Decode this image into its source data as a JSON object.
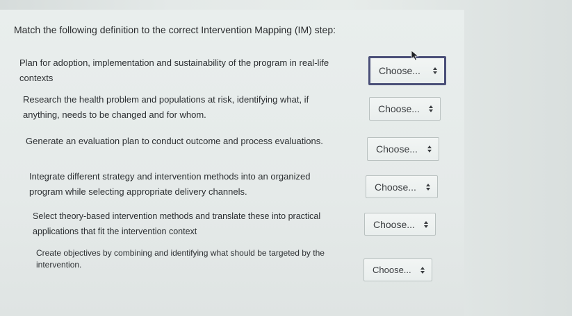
{
  "question": "Match the following definition to the correct Intervention Mapping (IM) step:",
  "placeholder": "Choose...",
  "items": [
    {
      "line1": "Plan for adoption, implementation and sustainability of the program in real-life",
      "line2": "contexts",
      "select_value": "Choose..."
    },
    {
      "line1": "Research the health problem and populations at risk, identifying what, if",
      "line2": "anything, needs to be changed and for whom.",
      "select_value": "Choose..."
    },
    {
      "line1": "Generate an evaluation plan to conduct outcome and process evaluations.",
      "line2": "",
      "select_value": "Choose..."
    },
    {
      "line1": "Integrate different strategy and intervention methods into an organized",
      "line2": "program while selecting appropriate delivery channels.",
      "select_value": "Choose..."
    },
    {
      "line1": "Select theory-based intervention methods and translate these into practical",
      "line2": "applications that fit the intervention context",
      "select_value": "Choose..."
    },
    {
      "line1": "Create objectives by combining and identifying what should be targeted by the",
      "line2": "intervention.",
      "select_value": "Choose..."
    }
  ]
}
